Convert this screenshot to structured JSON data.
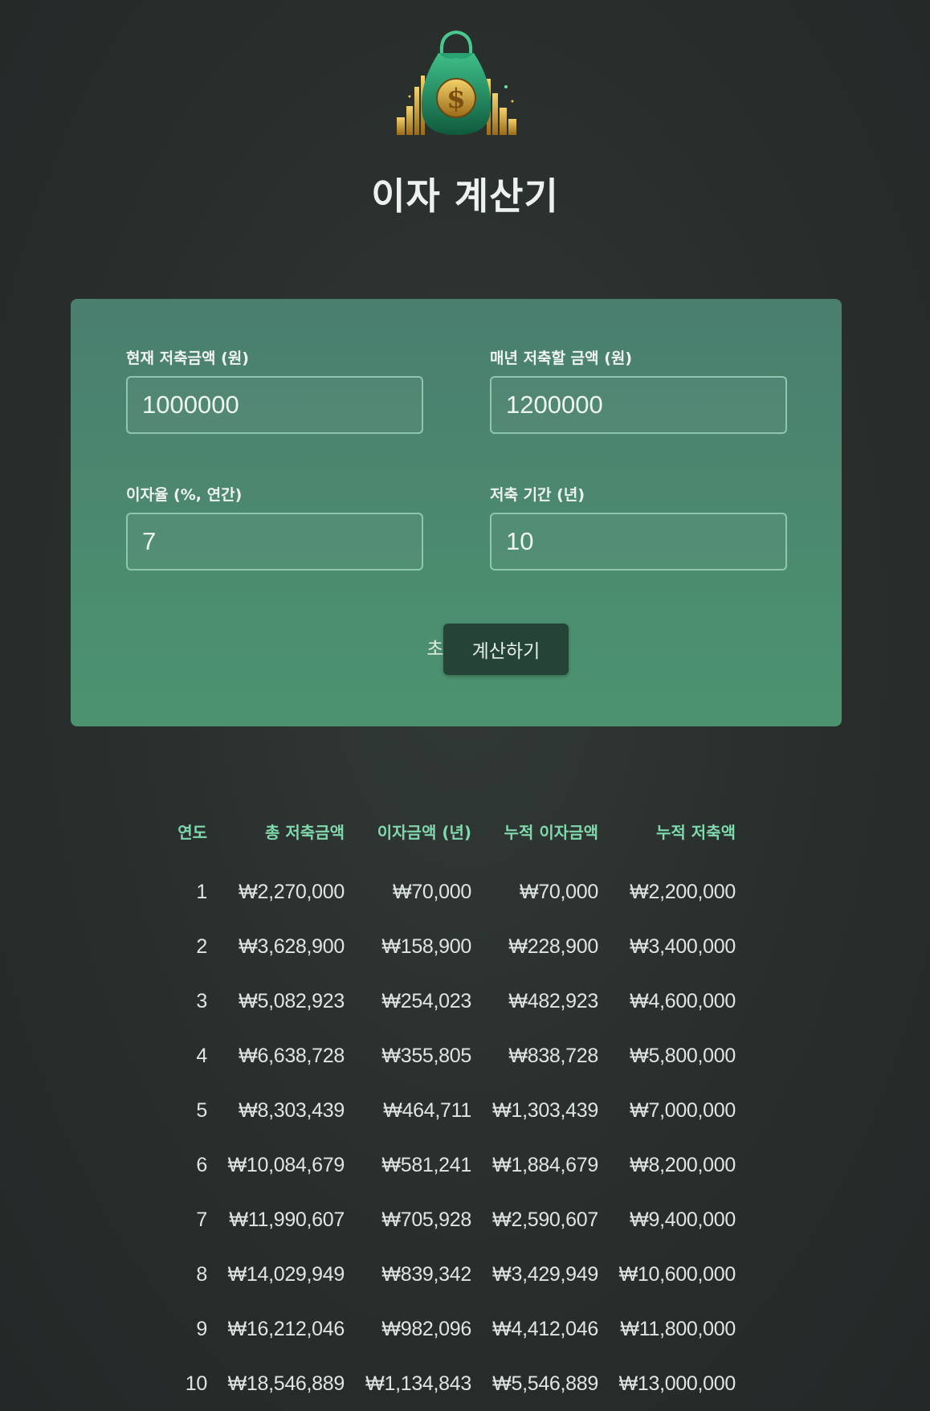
{
  "app": {
    "title": "이자 계산기",
    "logo_icon": "money-bag-icon"
  },
  "form": {
    "current_savings": {
      "label": "현재 저축금액 (원)",
      "value": "1000000"
    },
    "annual_deposit": {
      "label": "매년 저축할 금액 (원)",
      "value": "1200000"
    },
    "interest_rate": {
      "label": "이자율 (%, 연간)",
      "value": "7"
    },
    "period": {
      "label": "저축 기간 (년)",
      "value": "10"
    },
    "reset_label": "초기화",
    "calculate_label": "계산하기"
  },
  "table": {
    "headers": [
      "연도",
      "총 저축금액",
      "이자금액 (년)",
      "누적 이자금액",
      "누적 저축액"
    ],
    "rows": [
      [
        "1",
        "₩2,270,000",
        "₩70,000",
        "₩70,000",
        "₩2,200,000"
      ],
      [
        "2",
        "₩3,628,900",
        "₩158,900",
        "₩228,900",
        "₩3,400,000"
      ],
      [
        "3",
        "₩5,082,923",
        "₩254,023",
        "₩482,923",
        "₩4,600,000"
      ],
      [
        "4",
        "₩6,638,728",
        "₩355,805",
        "₩838,728",
        "₩5,800,000"
      ],
      [
        "5",
        "₩8,303,439",
        "₩464,711",
        "₩1,303,439",
        "₩7,000,000"
      ],
      [
        "6",
        "₩10,084,679",
        "₩581,241",
        "₩1,884,679",
        "₩8,200,000"
      ],
      [
        "7",
        "₩11,990,607",
        "₩705,928",
        "₩2,590,607",
        "₩9,400,000"
      ],
      [
        "8",
        "₩14,029,949",
        "₩839,342",
        "₩3,429,949",
        "₩10,600,000"
      ],
      [
        "9",
        "₩16,212,046",
        "₩982,096",
        "₩4,412,046",
        "₩11,800,000"
      ],
      [
        "10",
        "₩18,546,889",
        "₩1,134,843",
        "₩5,546,889",
        "₩13,000,000"
      ]
    ]
  },
  "colors": {
    "background": "#2a302e",
    "card": "#4b8a6f",
    "accent": "#7fd9ad",
    "button": "#254437"
  }
}
